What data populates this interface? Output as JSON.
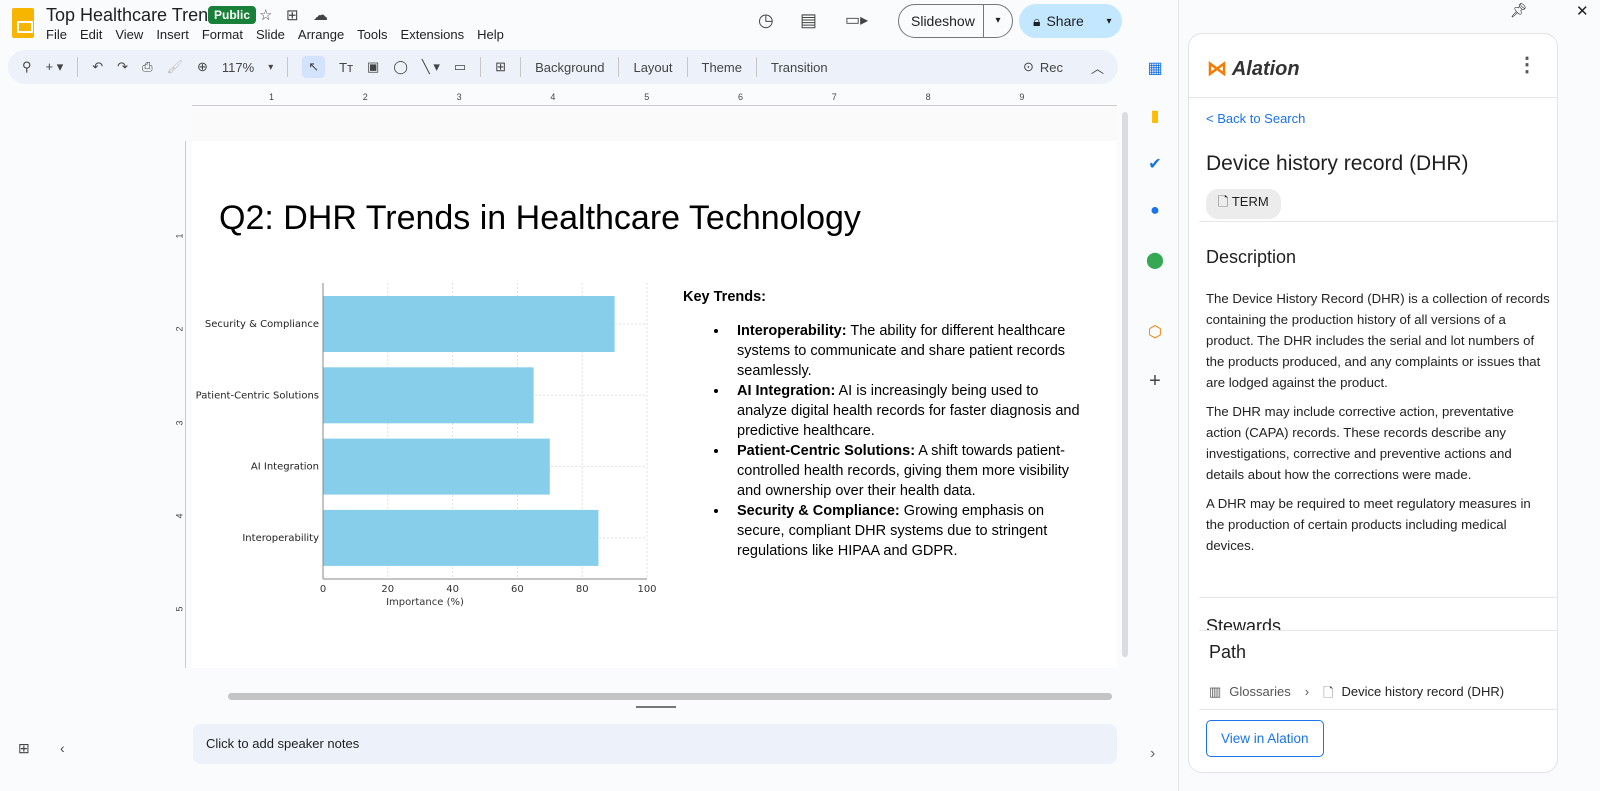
{
  "doc": {
    "title": "Top Healthcare Trends",
    "badge": "Public"
  },
  "menu": [
    "File",
    "Edit",
    "View",
    "Insert",
    "Format",
    "Slide",
    "Arrange",
    "Tools",
    "Extensions",
    "Help"
  ],
  "toolbar": {
    "zoom": "117%",
    "background": "Background",
    "layout": "Layout",
    "theme": "Theme",
    "transition": "Transition",
    "rec": "Rec"
  },
  "header": {
    "slideshow": "Slideshow",
    "share": "Share"
  },
  "ruler_h": [
    "1",
    "2",
    "3",
    "4",
    "5",
    "6",
    "7",
    "8",
    "9"
  ],
  "ruler_v": [
    "1",
    "2",
    "3",
    "4",
    "5"
  ],
  "slide": {
    "title": "Q2: DHR Trends in Healthcare Technology",
    "key_title": "Key Trends:",
    "trends": [
      {
        "bold": "Interoperability:",
        "text": " The ability for different healthcare systems to communicate and share patient records seamlessly."
      },
      {
        "bold": "AI Integration:",
        "text": " AI is increasingly being used to analyze digital health records for faster diagnosis and predictive healthcare."
      },
      {
        "bold": "Patient-Centric Solutions:",
        "text": " A shift towards patient-controlled health records, giving them more visibility and ownership over their health data."
      },
      {
        "bold": "Security & Compliance:",
        "text": " Growing emphasis on secure, compliant DHR systems due to stringent regulations like HIPAA and GDPR."
      }
    ]
  },
  "chart_data": {
    "type": "bar",
    "orientation": "horizontal",
    "categories": [
      "Security & Compliance",
      "Patient-Centric Solutions",
      "AI Integration",
      "Interoperability"
    ],
    "values": [
      90,
      65,
      70,
      85
    ],
    "xlabel": "Importance (%)",
    "ylabel": "",
    "xlim": [
      0,
      100
    ],
    "xticks": [
      "0",
      "20",
      "40",
      "60",
      "80",
      "100"
    ],
    "grid": true,
    "color": "#87ceeb"
  },
  "notes": {
    "placeholder": "Click to add speaker notes"
  },
  "panel": {
    "brand": "Alation",
    "back": "< Back to Search",
    "title": "Device history record (DHR)",
    "tag": "TERM",
    "description_heading": "Description",
    "description": [
      "The Device History Record (DHR) is a collection of records containing the production history of all versions of a product. The DHR includes the serial and lot numbers of the products produced, and any complaints or issues that are lodged against the product.",
      "The DHR may include corrective action, preventative action (CAPA) records. These records describe any investigations, corrective and preventive actions and details about how the corrections were made.",
      "A DHR may be required to meet regulatory measures in the production of certain products including medical devices."
    ],
    "stewards": "Stewards",
    "path_heading": "Path",
    "path": [
      "Glossaries",
      "Device history record (DHR)"
    ],
    "view_button": "View in Alation"
  }
}
